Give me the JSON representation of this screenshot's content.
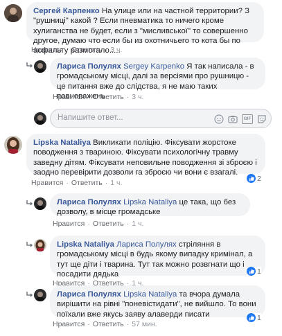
{
  "comments": [
    {
      "author": "Сергей Карпенко",
      "text": "На улице или на частной территории? З \"рушниці\" какой ? Если пневматика то ничего кроме хулиганства не будет, если з \"мисливської\" то совершенно другое, думаю что если бы из охотничьего то кота бы по асфальту размотало.....",
      "like_label": "Нравится",
      "reply_label": "Ответить",
      "time": "3 ч."
    },
    {
      "author": "Лариса Полулях",
      "mention": "Sergey Karpenko",
      "text": "Я так написала - в громадському місці, далі за версіями про рушницю - це питання вже до слідства, я не маю таких повноважень",
      "like_label": "Нравится",
      "reply_label": "Ответить",
      "time": "3 ч."
    },
    {
      "author": "Lipska Nataliya",
      "text": "Викликати поліцію. Фіксувати жорстоке поводження з твариною. Фіксувати психологічну травму заведну дітям. Фіксувати неповильне поводження зі зброєю і заодно перевірити дозволи га зброєю чи вони є взагалі.",
      "like_label": "Нравится",
      "reply_label": "Ответить",
      "time": "1 ч.",
      "reactions": "2"
    },
    {
      "author": "Лариса Полулях",
      "mention": "Lipska Nataliya",
      "text": "це така, що без дозволу, в місце громадське",
      "like_label": "Нравится",
      "reply_label": "Ответить",
      "time": "1 ч."
    },
    {
      "author": "Lipska Nataliya",
      "mention": "Лариса Полулях",
      "text": "стріляння в громадському місці в будь якому випадку кримінал, а тут ще діти і тварина. Тут так можно розвгнати що і посадити дядька",
      "like_label": "Нравится",
      "reply_label": "Ответить",
      "time": "1 ч.",
      "reactions": "1"
    },
    {
      "author": "Лариса Полулях",
      "mention": "Lipska Nataliya",
      "text": "та вчора думала вирішити на рівні \"поневістидати\", не вийшло. То вони поїхали вже якусь заяву алаверди писати",
      "like_label": "Нравится",
      "reply_label": "Ответить",
      "time": "57 мин.",
      "reactions": "1"
    }
  ],
  "reply_input": {
    "placeholder": "Напишите ответ..."
  },
  "icons": {
    "reply": "reply-arrow-icon",
    "emoji": "emoji-icon",
    "camera": "camera-icon",
    "gif": "gif-icon",
    "sticker": "sticker-icon"
  },
  "gif_label": "GIF",
  "colors": {
    "author": "#385898",
    "bubble": "#f2f3f5",
    "like": "#2078f4"
  }
}
